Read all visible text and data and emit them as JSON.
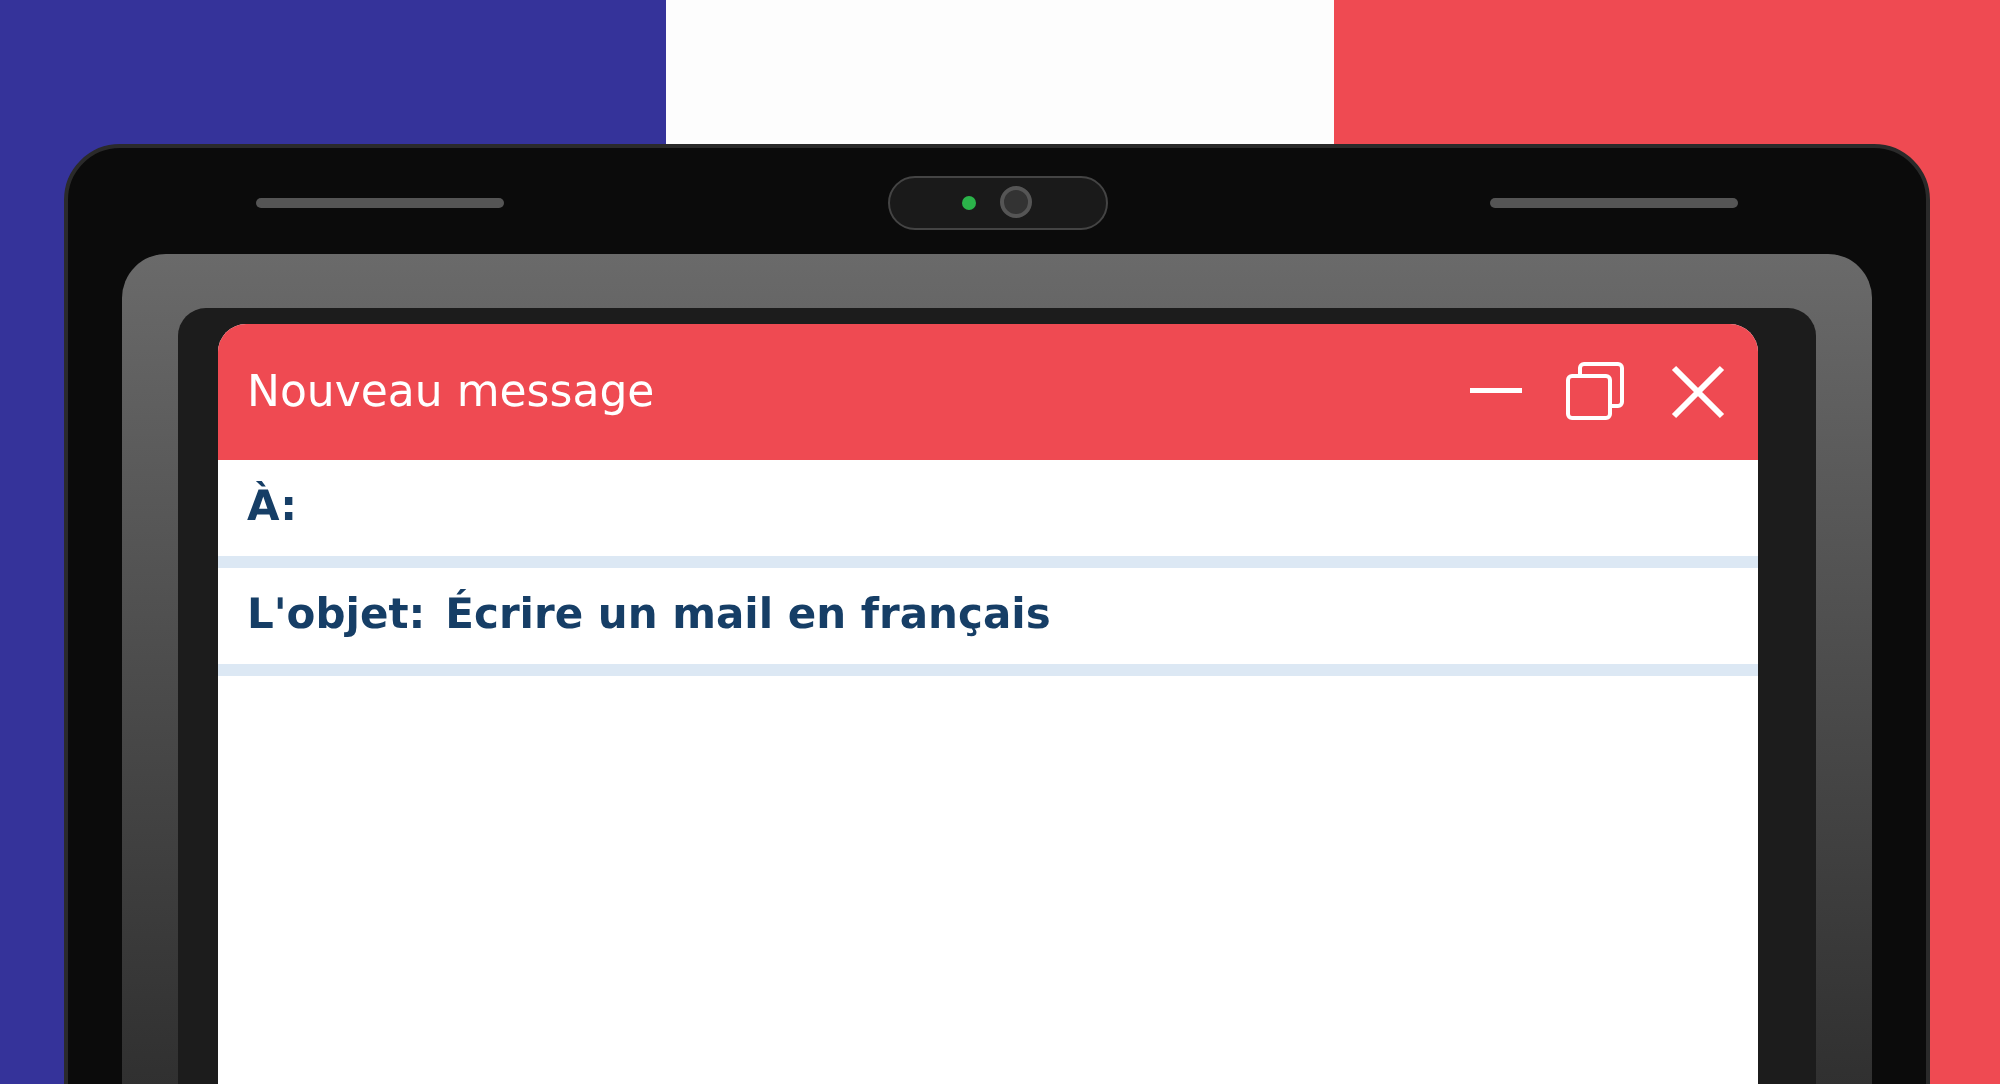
{
  "window": {
    "title": "Nouveau message"
  },
  "fields": [
    {
      "label": "À:"
    },
    {
      "label": "L'objet:",
      "value": "Écrire un mail en français"
    }
  ]
}
